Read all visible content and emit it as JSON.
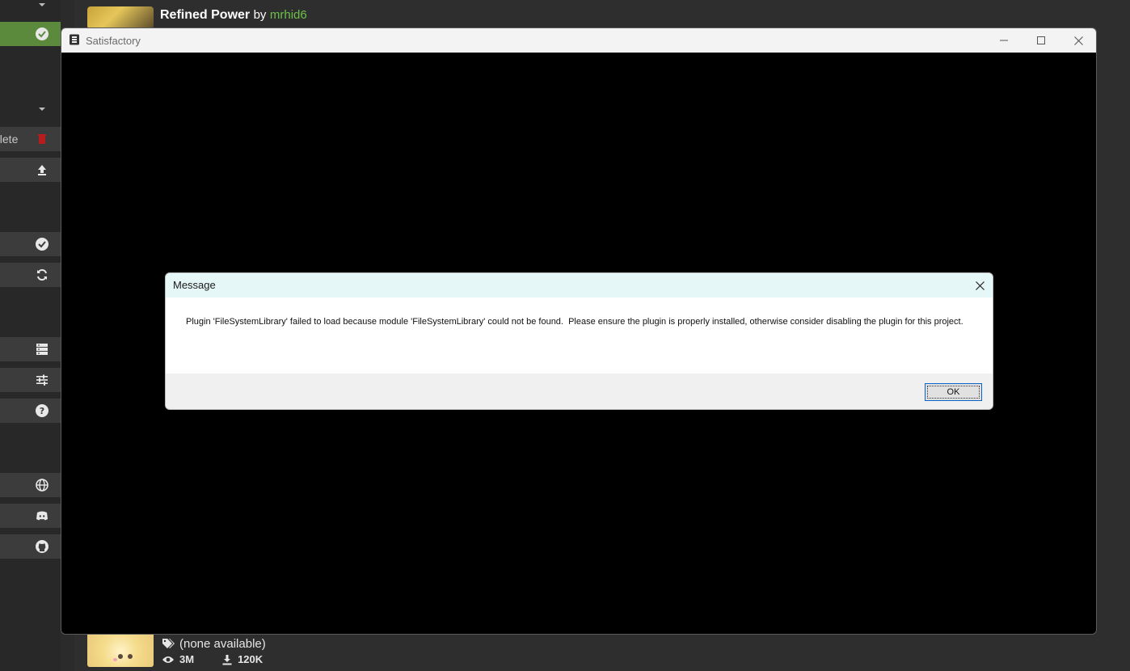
{
  "background_app": {
    "sidebar": {
      "delete_label": "elete",
      "icons": [
        "chevron-down-icon",
        "check-circle-icon",
        "chevron-down-icon",
        "trash-icon",
        "upload-icon",
        "check-circle-icon",
        "sync-icon",
        "server-icon",
        "sliders-icon",
        "help-circle-icon",
        "globe-icon",
        "discord-icon",
        "github-icon"
      ]
    },
    "mod_top": {
      "title": "Refined Power",
      "by": "by",
      "author": "mrhid6"
    },
    "mod_bottom": {
      "tags": "(none available)",
      "views": "3M",
      "downloads": "120K"
    },
    "colors": {
      "accent_green": "#6cc04a",
      "active_row": "#5b8a3c",
      "delete_red": "#b81d1d"
    }
  },
  "game_window": {
    "title": "Satisfactory",
    "controls": [
      "minimize-icon",
      "maximize-icon",
      "close-icon"
    ]
  },
  "dialog": {
    "title": "Message",
    "message": "Plugin 'FileSystemLibrary' failed to load because module 'FileSystemLibrary' could not be found.  Please ensure the plugin is properly installed, otherwise consider disabling the plugin for this project.",
    "ok_label": "OK"
  }
}
